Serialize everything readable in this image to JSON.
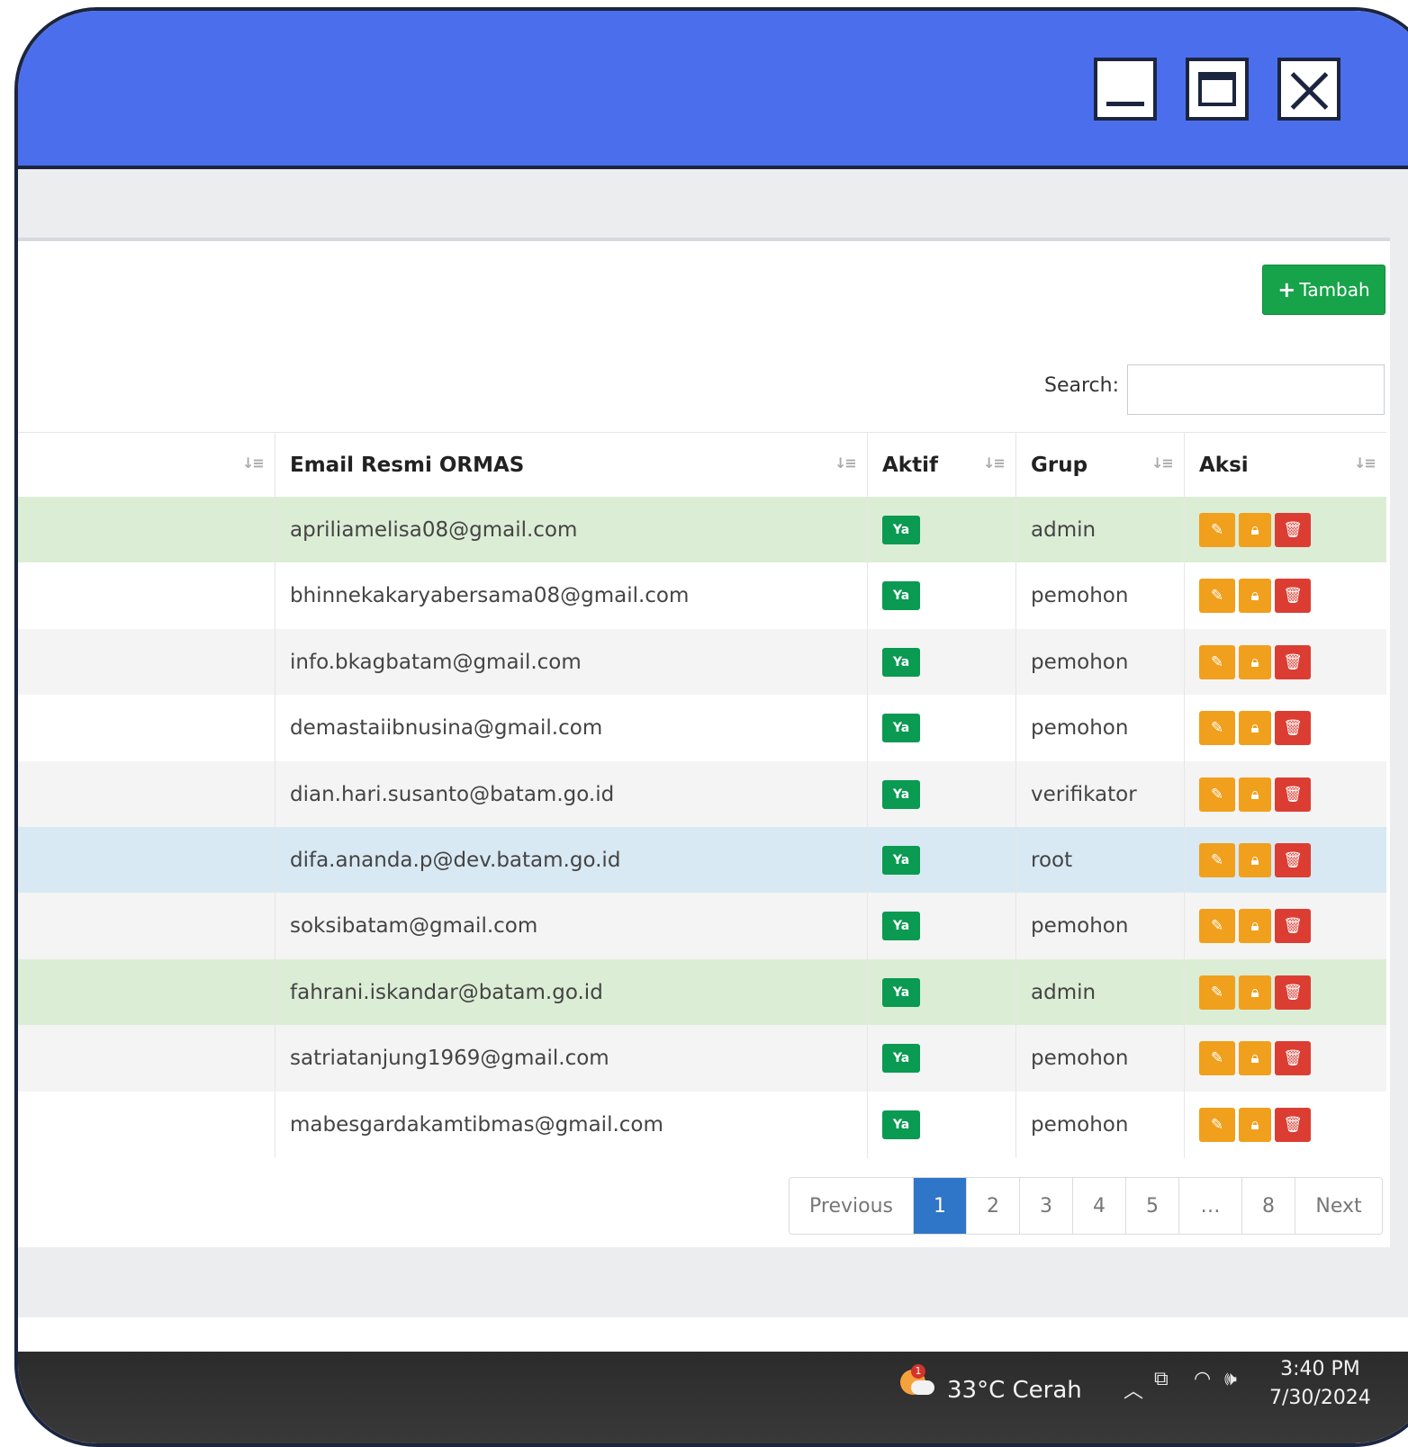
{
  "toolbar": {
    "add_label": "Tambah"
  },
  "search": {
    "label": "Search:",
    "value": ""
  },
  "table": {
    "headers": {
      "email": "Email Resmi ORMAS",
      "aktif": "Aktif",
      "grup": "Grup",
      "aksi": "Aksi"
    },
    "rows": [
      {
        "email": "apriliamelisa08@gmail.com",
        "aktif": "Ya",
        "grup": "admin",
        "bg": "#dcedd6"
      },
      {
        "email": "bhinnekakaryabersama08@gmail.com",
        "aktif": "Ya",
        "grup": "pemohon",
        "bg": "#ffffff"
      },
      {
        "email": "info.bkagbatam@gmail.com",
        "aktif": "Ya",
        "grup": "pemohon",
        "bg": "#f4f4f4"
      },
      {
        "email": "demastaiibnusina@gmail.com",
        "aktif": "Ya",
        "grup": "pemohon",
        "bg": "#ffffff"
      },
      {
        "email": "dian.hari.susanto@batam.go.id",
        "aktif": "Ya",
        "grup": "verifikator",
        "bg": "#f4f4f4"
      },
      {
        "email": "difa.ananda.p@dev.batam.go.id",
        "aktif": "Ya",
        "grup": "root",
        "bg": "#d8e9f3"
      },
      {
        "email": "soksibatam@gmail.com",
        "aktif": "Ya",
        "grup": "pemohon",
        "bg": "#f4f4f4"
      },
      {
        "email": "fahrani.iskandar@batam.go.id",
        "aktif": "Ya",
        "grup": "admin",
        "bg": "#dcedd6"
      },
      {
        "email": "satriatanjung1969@gmail.com",
        "aktif": "Ya",
        "grup": "pemohon",
        "bg": "#f4f4f4"
      },
      {
        "email": "mabesgardakamtibmas@gmail.com",
        "aktif": "Ya",
        "grup": "pemohon",
        "bg": "#ffffff"
      }
    ]
  },
  "pagination": {
    "previous": "Previous",
    "pages": [
      "1",
      "2",
      "3",
      "4",
      "5",
      "…",
      "8"
    ],
    "active": "1",
    "next": "Next"
  },
  "taskbar": {
    "weather_badge": "1",
    "weather": "33°C  Cerah",
    "time": "3:40 PM",
    "date": "7/30/2024"
  },
  "colors": {
    "titlebar": "#4b6fec",
    "add_button": "#17a34a",
    "badge_ya": "#0a9a52",
    "edit": "#f0a01d",
    "delete": "#dc3d33",
    "active_page": "#2f76c8"
  }
}
